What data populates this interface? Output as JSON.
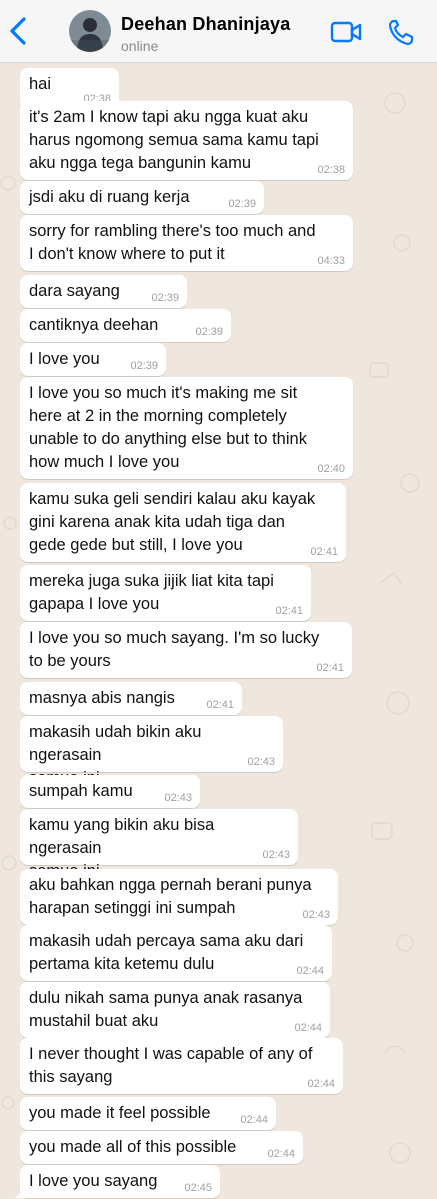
{
  "header": {
    "contact_name": "Deehan Dhaninjaya",
    "status": "online",
    "accent_color": "#007aff",
    "back_icon": "chevron-left-icon",
    "video_icon": "video-camera-icon",
    "call_icon": "phone-icon"
  },
  "messages": [
    {
      "text": "hai",
      "time": "02:38"
    },
    {
      "text": "it's 2am I know tapi aku ngga kuat aku\nharus ngomong semua sama kamu tapi\naku ngga tega bangunin kamu",
      "time": "02:38"
    },
    {
      "text": "jsdi aku di ruang kerja",
      "time": "02:39"
    },
    {
      "text": "sorry for rambling there's too much and\nI don't know where to put it",
      "time": "04:33"
    },
    {
      "text": "dara sayang",
      "time": "02:39"
    },
    {
      "text": "cantiknya deehan",
      "time": "02:39"
    },
    {
      "text": "I love you",
      "time": "02:39"
    },
    {
      "text": "I love you so much it's making me sit\nhere at 2 in the morning completely\nunable to do anything else but to think\nhow much I love you",
      "time": "02:40"
    },
    {
      "text": "kamu suka geli sendiri kalau aku kayak\ngini karena anak kita udah tiga dan\ngede gede but still, I love you",
      "time": "02:41"
    },
    {
      "text": "mereka juga suka jijik liat kita tapi\ngapapa I love you",
      "time": "02:41"
    },
    {
      "text": "I love you so much sayang. I'm so lucky\nto be yours",
      "time": "02:41"
    },
    {
      "text": "masnya abis nangis",
      "time": "02:41"
    },
    {
      "text": "makasih udah bikin aku ngerasain\nsemua ini",
      "time": "02:43"
    },
    {
      "text": "sumpah kamu",
      "time": "02:43"
    },
    {
      "text": "kamu yang bikin aku bisa ngerasain\nsemua ini",
      "time": "02:43"
    },
    {
      "text": "aku bahkan ngga pernah berani punya\nharapan setinggi ini sumpah",
      "time": "02:43"
    },
    {
      "text": "makasih udah percaya sama aku dari\npertama kita ketemu dulu",
      "time": "02:44"
    },
    {
      "text": "dulu nikah sama punya anak rasanya\nmustahil buat aku",
      "time": "02:44"
    },
    {
      "text": "I never thought I was capable of any of\nthis sayang",
      "time": "02:44"
    },
    {
      "text": "you made it feel possible",
      "time": "02:44"
    },
    {
      "text": "you made all of this possible",
      "time": "02:44"
    },
    {
      "text": "I love you sayang",
      "time": "02:45"
    }
  ]
}
